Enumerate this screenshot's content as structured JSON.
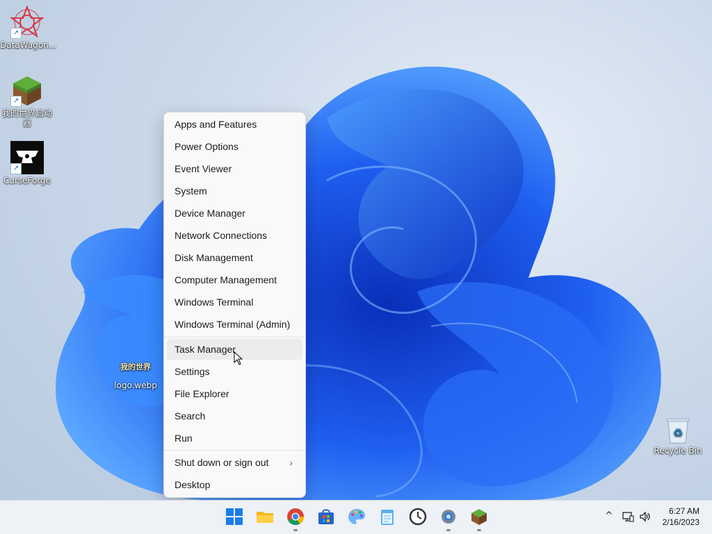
{
  "desktop": {
    "icons": [
      {
        "label": "DataWagon..."
      },
      {
        "label": "我的世界启动器"
      },
      {
        "label": "CurseForge"
      },
      {
        "label": "logo.webp",
        "thumb_text": "我的世界"
      },
      {
        "label": "Recycle Bin"
      }
    ]
  },
  "context_menu": {
    "items": [
      {
        "label": "Apps and Features"
      },
      {
        "label": "Power Options"
      },
      {
        "label": "Event Viewer"
      },
      {
        "label": "System"
      },
      {
        "label": "Device Manager"
      },
      {
        "label": "Network Connections"
      },
      {
        "label": "Disk Management"
      },
      {
        "label": "Computer Management"
      },
      {
        "label": "Windows Terminal"
      },
      {
        "label": "Windows Terminal (Admin)"
      },
      {
        "label": "Task Manager"
      },
      {
        "label": "Settings"
      },
      {
        "label": "File Explorer"
      },
      {
        "label": "Search"
      },
      {
        "label": "Run"
      },
      {
        "label": "Shut down or sign out",
        "chevron": "›"
      },
      {
        "label": "Desktop"
      }
    ],
    "hovered": "Task Manager"
  },
  "taskbar": {
    "apps": [
      "start-icon",
      "file-explorer-icon",
      "chrome-icon",
      "store-icon",
      "paint-icon",
      "notepad-icon",
      "clock-app-icon",
      "settings-icon",
      "minecraft-icon"
    ],
    "tray": {
      "chevron": "^",
      "network_icon": "network-icon",
      "volume_icon": "volume-icon"
    },
    "clock": {
      "time": "6:27 AM",
      "date": "2/16/2023"
    }
  },
  "colors": {
    "accent": "#0067c0",
    "wallpaper_blue": "#1a55e0"
  }
}
